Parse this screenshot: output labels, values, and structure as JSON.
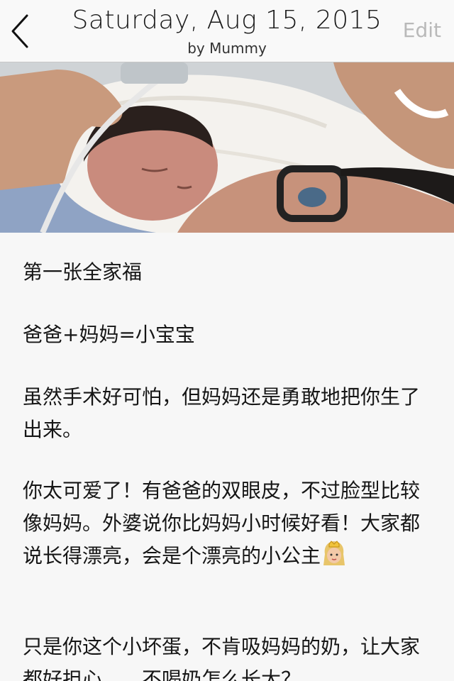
{
  "header": {
    "back_icon": "chevron-left-icon",
    "title": "Saturday, Aug 15, 2015",
    "subtitle": "by Mummy",
    "edit_label": "Edit"
  },
  "entry": {
    "paragraphs": [
      "第一张全家福",
      "爸爸+妈妈=小宝宝",
      "虽然手术好可怕，但妈妈还是勇敢地把你生了出来。",
      "你太可爱了！有爸爸的双眼皮，不过脸型比较像妈妈。外婆说你比妈妈小时候好看！大家都说长得漂亮，会是个漂亮的小公主",
      "只是你这个小坏蛋，不肯吸妈妈的奶，让大家都好担心。。。不喝奶怎么长大？"
    ],
    "emoji": "princess-emoji-icon"
  },
  "colors": {
    "accent": "#b9b9b9",
    "text": "#161616",
    "background": "#f7f7f7"
  }
}
